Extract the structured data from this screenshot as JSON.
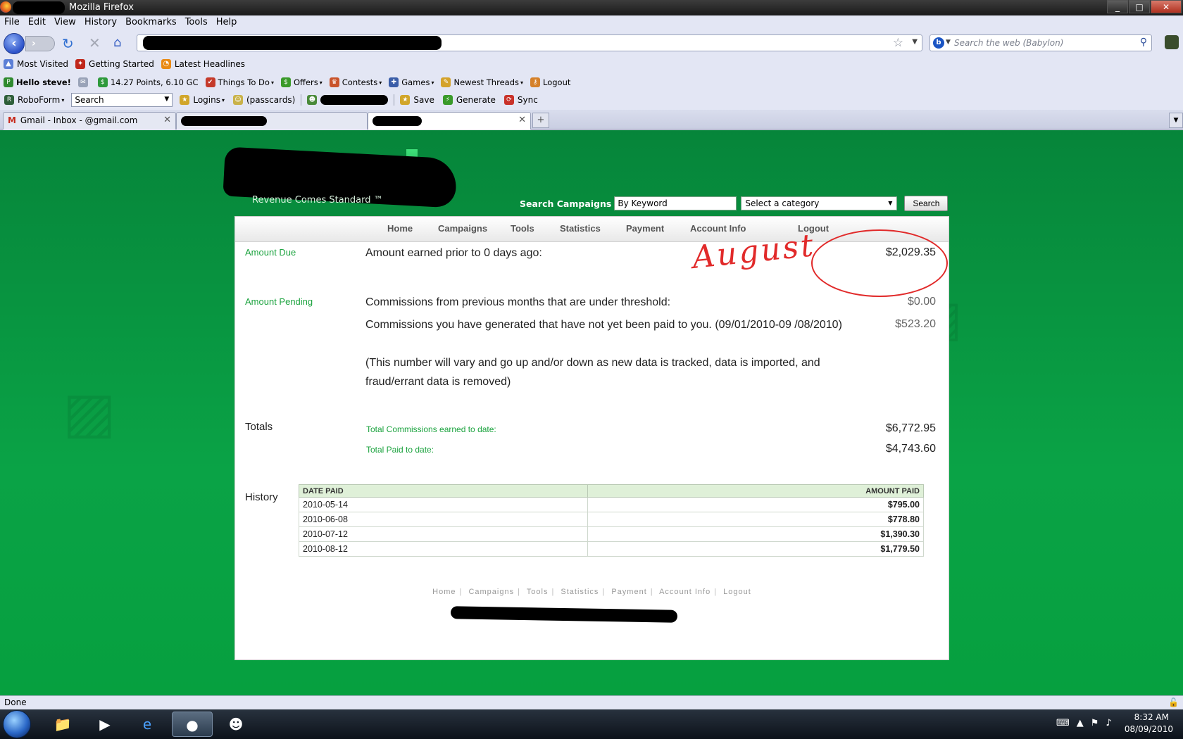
{
  "window": {
    "title": "Mozilla Firefox",
    "min": "_",
    "max": "□",
    "close": "✕"
  },
  "menu": [
    "File",
    "Edit",
    "View",
    "History",
    "Bookmarks",
    "Tools",
    "Help"
  ],
  "nav": {
    "search_placeholder": "Search the web (Babylon)"
  },
  "bookmarks": [
    "Most Visited",
    "Getting Started",
    "Latest Headlines"
  ],
  "addon": {
    "hello": "Hello steve!",
    "points": "14.27 Points, 6.10 GC",
    "items": [
      "Things To Do",
      "Offers",
      "Contests",
      "Games",
      "Newest Threads",
      "Logout"
    ]
  },
  "roboform": {
    "label": "RoboForm",
    "search": "Search",
    "logins": "Logins",
    "passcards": "(passcards)",
    "save": "Save",
    "generate": "Generate",
    "sync": "Sync"
  },
  "tabs": {
    "gmail": "Gmail - Inbox - ",
    "gmail_tail": "@gmail.com"
  },
  "site": {
    "tagline": "Revenue Comes Standard ™",
    "search_label": "Search Campaigns",
    "keyword_value": "By Keyword",
    "category_value": "Select a category",
    "search_button": "Search",
    "nav": [
      "Home",
      "Campaigns",
      "Tools",
      "Statistics",
      "Payment",
      "Account Info",
      "Logout"
    ]
  },
  "account": {
    "due_label": "Amount Due",
    "due_desc": "Amount earned prior to 0 days ago:",
    "due_amount": "$2,029.35",
    "pending_label": "Amount Pending",
    "pending_desc1": "Commissions from previous months that are under threshold:",
    "pending_amount1": "$0.00",
    "pending_desc2": "Commissions you have generated that have not yet been paid to you. (09/01/2010-09 /08/2010)",
    "pending_desc3": "(This number will vary and go up and/or down as new data is tracked, data is imported, and fraud/errant data is removed)",
    "pending_amount2": "$523.20",
    "totals_label": "Totals",
    "total_comm_label": "Total Commissions earned to date:",
    "total_comm": "$6,772.95",
    "total_paid_label": "Total Paid to date:",
    "total_paid": "$4,743.60",
    "history_label": "History"
  },
  "history": {
    "headers": [
      "DATE PAID",
      "AMOUNT PAID"
    ],
    "rows": [
      [
        "2010-05-14",
        "$795.00"
      ],
      [
        "2010-06-08",
        "$778.80"
      ],
      [
        "2010-07-12",
        "$1,390.30"
      ],
      [
        "2010-08-12",
        "$1,779.50"
      ]
    ]
  },
  "footer": [
    "Home",
    "Campaigns",
    "Tools",
    "Statistics",
    "Payment",
    "Account Info",
    "Logout"
  ],
  "annotation": "August",
  "status": "Done",
  "clock": {
    "time": "8:32 AM",
    "date": "08/09/2010"
  },
  "colors": {
    "site_green": "#0aa346",
    "label_green": "#1ca33f",
    "annotation_red": "#e12a2a"
  }
}
